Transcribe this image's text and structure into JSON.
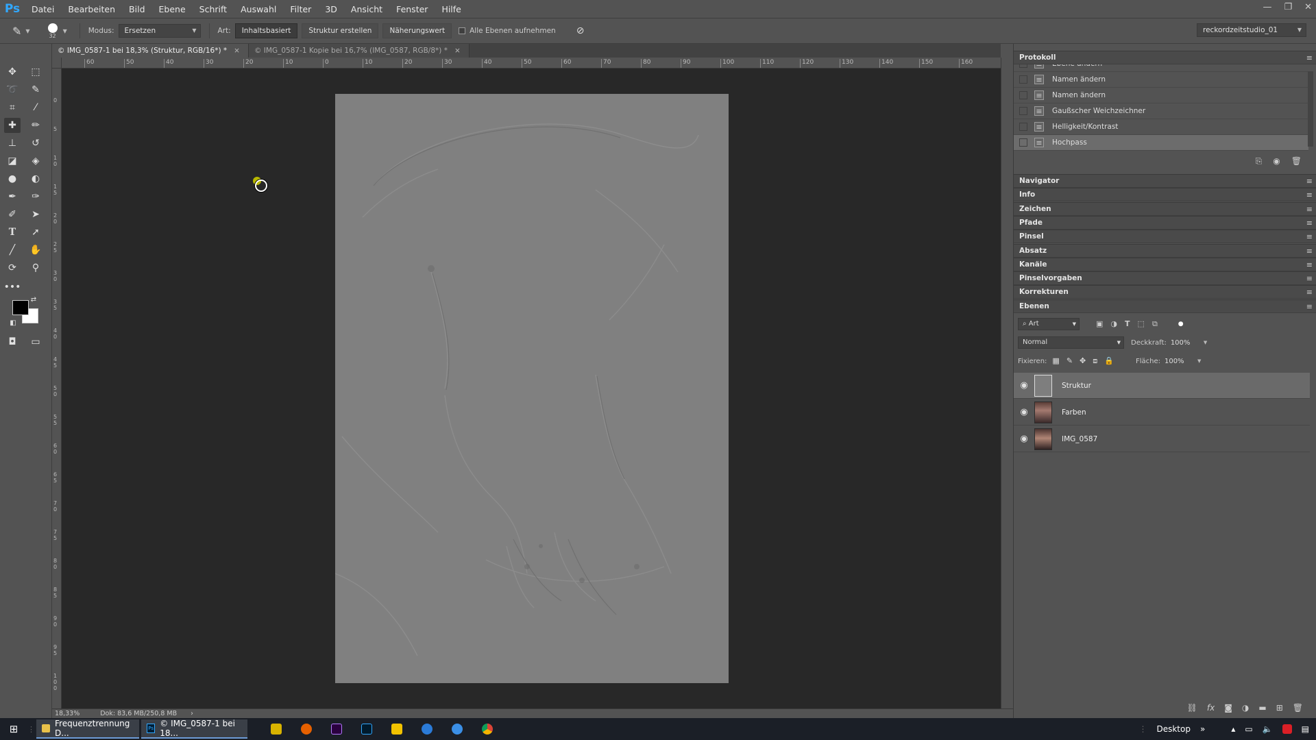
{
  "app": {
    "logo": "Ps"
  },
  "menu": [
    "Datei",
    "Bearbeiten",
    "Bild",
    "Ebene",
    "Schrift",
    "Auswahl",
    "Filter",
    "3D",
    "Ansicht",
    "Fenster",
    "Hilfe"
  ],
  "window_controls": [
    "minimize-icon",
    "restore-icon",
    "close-icon"
  ],
  "options": {
    "brush_size": "32",
    "mode_label": "Modus:",
    "mode_value": "Ersetzen",
    "type_label": "Art:",
    "btn_content": "Inhaltsbasiert",
    "btn_structure": "Struktur erstellen",
    "btn_approx": "Näherungswert",
    "sample_all": "Alle Ebenen aufnehmen",
    "sample_all_checked": false,
    "workspace": "reckordzeitstudio_01"
  },
  "tabs": [
    {
      "label": "© IMG_0587-1 bei 18,3% (Struktur, RGB/16*) *",
      "active": true
    },
    {
      "label": "© IMG_0587-1 Kopie bei 16,7% (IMG_0587, RGB/8*) *",
      "active": false
    }
  ],
  "ruler": {
    "h": [
      "60",
      "50",
      "40",
      "30",
      "20",
      "10",
      "0",
      "10",
      "20",
      "30",
      "40",
      "50",
      "60",
      "70",
      "80",
      "90",
      "100",
      "110",
      "120",
      "130",
      "140",
      "150",
      "160"
    ],
    "v": [
      "0",
      "5",
      "10",
      "15",
      "20",
      "25",
      "30",
      "35",
      "40",
      "45",
      "50",
      "55",
      "60",
      "65",
      "70",
      "75",
      "80",
      "85",
      "90",
      "95",
      "100"
    ]
  },
  "status": {
    "zoom": "18,33%",
    "doc": "Dok: 83,6 MB/250,8 MB"
  },
  "panels": {
    "history": {
      "title": "Protokoll",
      "items": [
        {
          "label": "Ebene ändern",
          "active": false
        },
        {
          "label": "Namen ändern",
          "active": false
        },
        {
          "label": "Namen ändern",
          "active": false
        },
        {
          "label": "Gaußscher Weichzeichner",
          "active": false
        },
        {
          "label": "Helligkeit/Kontrast",
          "active": false
        },
        {
          "label": "Hochpass",
          "active": true
        }
      ]
    },
    "collapsed": [
      "Navigator",
      "Info",
      "Zeichen",
      "Pfade",
      "Pinsel",
      "Absatz",
      "Kanäle",
      "Pinselvorgaben",
      "Korrekturen"
    ],
    "layers": {
      "title": "Ebenen",
      "filter_kind": "Art",
      "blend_mode": "Normal",
      "opacity_label": "Deckkraft:",
      "opacity": "100%",
      "lock_label": "Fixieren:",
      "fill_label": "Fläche:",
      "fill": "100%",
      "items": [
        {
          "name": "Struktur",
          "visible": true,
          "active": true
        },
        {
          "name": "Farben",
          "visible": true,
          "active": false
        },
        {
          "name": "IMG_0587",
          "visible": true,
          "active": false
        }
      ]
    }
  },
  "taskbar": {
    "items": [
      {
        "label": "Frequenztrennung D...",
        "icon": "folder-icon"
      },
      {
        "label": "© IMG_0587-1 bei 18...",
        "icon": "photoshop-icon"
      }
    ],
    "desktop": "Desktop"
  },
  "colors": {
    "accent": "#31a8ff",
    "canvas_bg": "#282828",
    "doc_gray": "#808080",
    "panel": "#535353"
  }
}
